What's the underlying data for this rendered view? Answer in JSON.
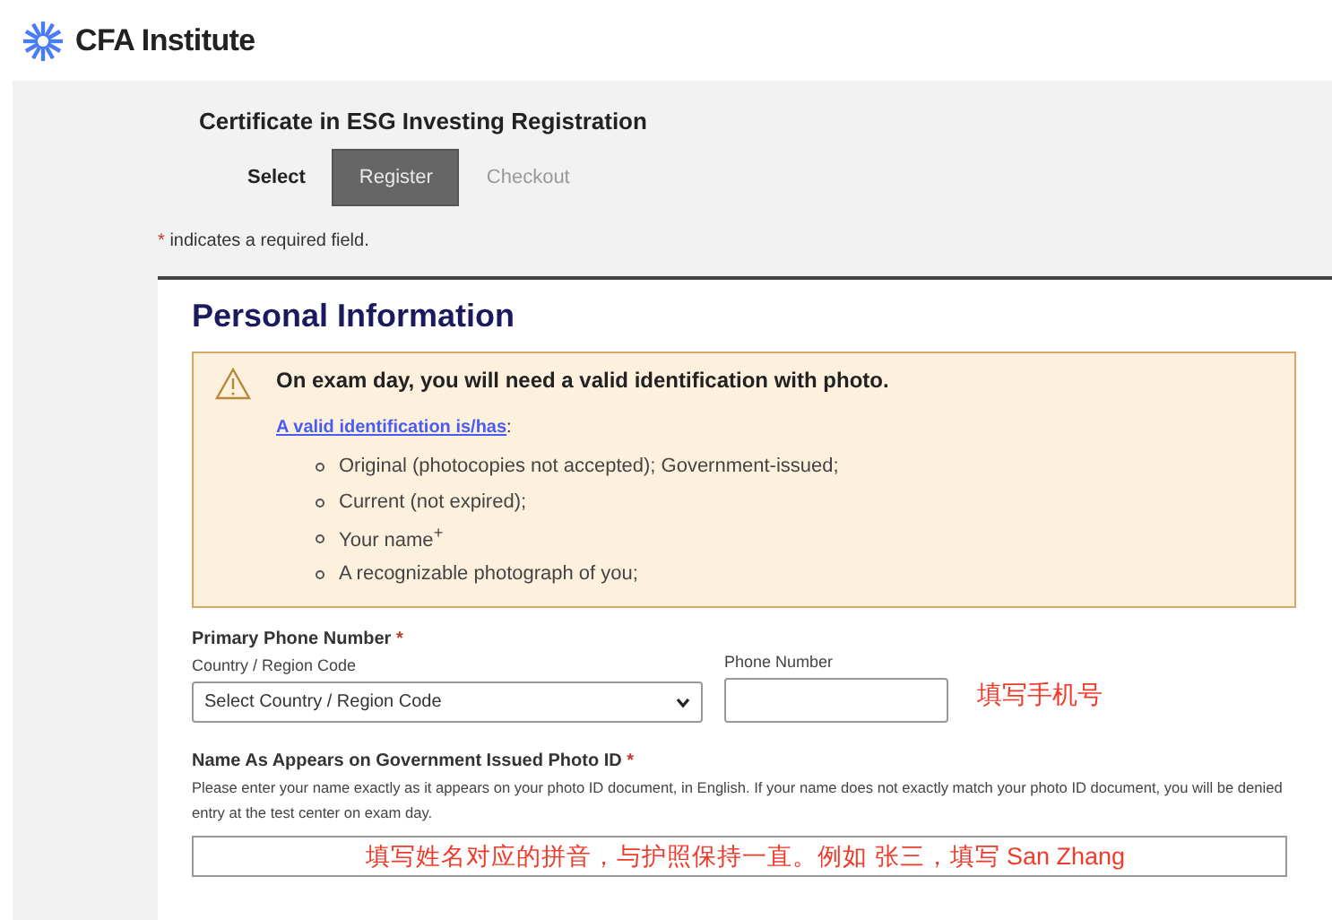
{
  "header": {
    "logo_text": "CFA Institute"
  },
  "registration": {
    "title": "Certificate in ESG Investing Registration",
    "steps": [
      {
        "label": "Select",
        "selected": false,
        "completed": true
      },
      {
        "label": "Register",
        "selected": true,
        "completed": false
      },
      {
        "label": "Checkout",
        "selected": false,
        "completed": false
      }
    ],
    "required_note": {
      "mark": "*",
      "text": "indicates a required field."
    }
  },
  "section": {
    "title": "Personal Information",
    "notice": {
      "heading": "On exam day, you will need a valid identification with photo.",
      "link": "A valid identification is/has",
      "link_suffix": ":",
      "items": [
        "Original (photocopies not accepted); Government-issued;",
        "Current (not expired);",
        "Your name$^{+}$",
        "A recognizable photograph of you;"
      ]
    },
    "phone": {
      "label": "Primary Phone Number",
      "required_mark": "*",
      "country_label": "Country / Region Code",
      "country_value": "Select Country / Region Code",
      "number_label": "Phone Number",
      "annotation": "填写手机号"
    },
    "name": {
      "label": "Name As Appears on Government Issued Photo ID",
      "required_mark": "*",
      "help": "Please enter your name exactly as it appears on your photo ID document, in English. If your name does not exactly match your photo ID document, you will be denied entry at the test center on exam day.",
      "annotation": "填写姓名对应的拼音，与护照保持一直。例如 张三，填写 San Zhang"
    }
  }
}
